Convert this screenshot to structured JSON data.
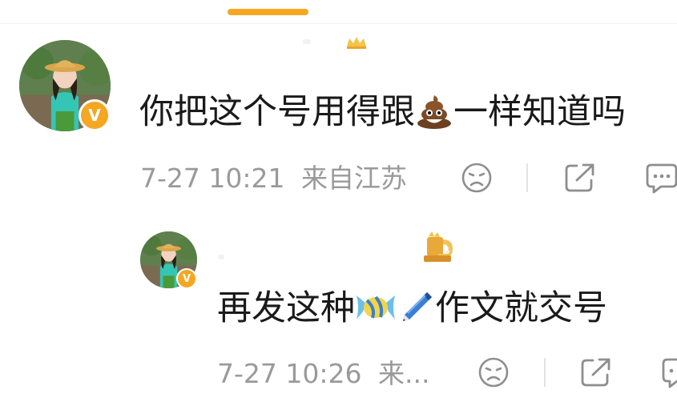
{
  "comments": [
    {
      "text_a": "你把这个号用得跟",
      "emoji": "poop-emoji",
      "text_b": "一样知道吗",
      "timestamp": "7-27 10:21",
      "location": "来自江苏",
      "verified_badge": "V"
    },
    {
      "text_a": "再发这种",
      "emoji_1": "candy-emoji",
      "emoji_2": "pen-emoji",
      "text_b": "作文就交号",
      "timestamp": "7-27 10:26",
      "location": "来...",
      "verified_badge": "V"
    }
  ],
  "colors": {
    "accent": "#F7A823",
    "badge": "#F5A623",
    "text": "#1a1a1a",
    "meta": "#9a9a9a"
  },
  "icons": {
    "dislike": "sad-face-icon",
    "share": "share-icon",
    "comment": "comment-icon"
  }
}
